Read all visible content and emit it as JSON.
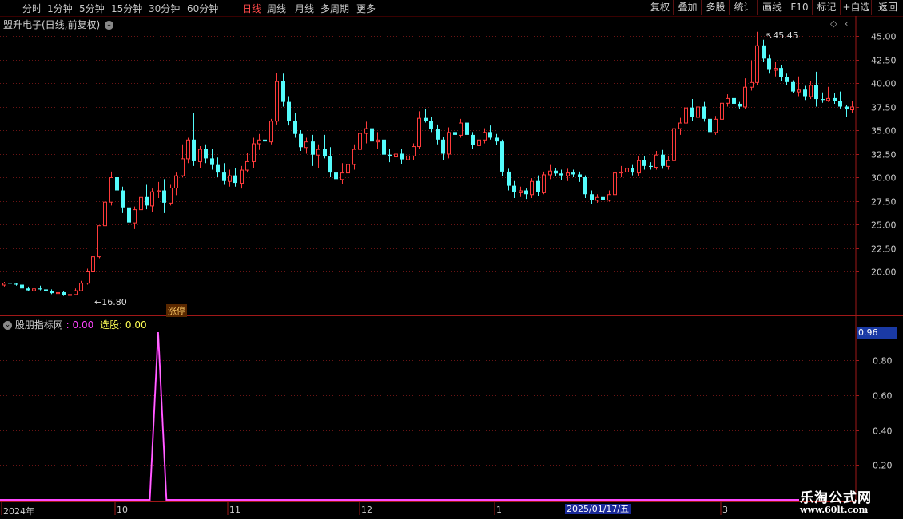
{
  "toolbar": {
    "periods": [
      "分时",
      "1分钟",
      "5分钟",
      "15分钟",
      "30分钟",
      "60分钟",
      "日线",
      "周线",
      "月线",
      "多周期",
      "更多"
    ],
    "active_period": "日线",
    "buttons": [
      "复权",
      "叠加",
      "多股",
      "统计",
      "画线",
      "F10",
      "标记",
      "+自选",
      "返回"
    ]
  },
  "main_chart": {
    "title": "盟升电子(日线,前复权)",
    "y_ticks": [
      "45.00",
      "42.50",
      "40.00",
      "37.50",
      "35.00",
      "32.50",
      "30.00",
      "27.50",
      "25.00",
      "22.50",
      "20.00"
    ],
    "high_label": "45.45",
    "low_label": "16.80",
    "badge": "涨停"
  },
  "indicator": {
    "name": "股朋指标网",
    "value_label": ": 0.00",
    "select_label": "选股: 0.00",
    "current_value": "0.96",
    "y_ticks": [
      "0.80",
      "0.60",
      "0.40",
      "0.20"
    ]
  },
  "x_axis": {
    "labels": [
      "2024年",
      "10",
      "11",
      "12",
      "1",
      "2025/01/17/五",
      "3"
    ]
  },
  "watermark": {
    "title": "乐淘公式网",
    "url": "www.60lt.com"
  },
  "colors": {
    "up": "#ff3b3b",
    "down": "#54fcfc",
    "grid": "#7a1a1a",
    "indicator_line": "#ff33ff"
  },
  "chart_data": {
    "type": "candlestick",
    "title": "盟升电子(日线,前复权)",
    "price_range": [
      16.0,
      46.5
    ],
    "high": 45.45,
    "low": 16.8,
    "candles": [
      [
        18.6,
        18.9,
        18.4,
        18.8
      ],
      [
        18.8,
        18.9,
        18.6,
        18.7
      ],
      [
        18.7,
        18.8,
        18.5,
        18.6
      ],
      [
        18.6,
        18.8,
        18.1,
        18.2
      ],
      [
        18.2,
        18.4,
        17.9,
        18.0
      ],
      [
        18.0,
        18.3,
        17.9,
        18.2
      ],
      [
        18.2,
        18.5,
        18.0,
        18.1
      ],
      [
        18.1,
        18.3,
        17.8,
        17.9
      ],
      [
        17.9,
        18.1,
        17.6,
        17.7
      ],
      [
        17.7,
        17.9,
        17.5,
        17.8
      ],
      [
        17.8,
        17.9,
        17.4,
        17.5
      ],
      [
        17.5,
        17.8,
        17.2,
        17.6
      ],
      [
        17.6,
        18.2,
        17.5,
        18.0
      ],
      [
        18.0,
        19.0,
        17.9,
        18.8
      ],
      [
        18.8,
        20.3,
        18.6,
        20.0
      ],
      [
        20.0,
        21.6,
        19.8,
        21.6
      ],
      [
        21.6,
        23.8,
        21.4,
        24.9
      ],
      [
        24.9,
        28.0,
        24.6,
        27.4
      ],
      [
        27.4,
        30.6,
        27.0,
        30.0
      ],
      [
        30.0,
        30.5,
        28.3,
        28.6
      ],
      [
        28.6,
        29.0,
        26.2,
        26.8
      ],
      [
        26.8,
        27.1,
        24.8,
        25.2
      ],
      [
        25.2,
        26.9,
        24.5,
        26.6
      ],
      [
        26.6,
        28.3,
        26.1,
        27.9
      ],
      [
        27.9,
        29.2,
        26.6,
        27.0
      ],
      [
        27.0,
        28.8,
        26.3,
        28.5
      ],
      [
        28.5,
        29.5,
        27.8,
        28.6
      ],
      [
        28.6,
        29.8,
        26.2,
        27.3
      ],
      [
        27.3,
        29.2,
        27.0,
        28.9
      ],
      [
        28.9,
        30.5,
        28.1,
        30.2
      ],
      [
        30.2,
        33.5,
        30.0,
        32.0
      ],
      [
        32.0,
        34.2,
        31.5,
        34.0
      ],
      [
        34.0,
        36.8,
        31.2,
        31.7
      ],
      [
        31.7,
        33.3,
        31.0,
        33.0
      ],
      [
        33.0,
        33.5,
        31.5,
        32.0
      ],
      [
        32.0,
        33.0,
        30.8,
        31.3
      ],
      [
        31.3,
        32.1,
        30.0,
        30.5
      ],
      [
        30.5,
        31.5,
        29.2,
        29.6
      ],
      [
        29.6,
        30.8,
        29.0,
        30.2
      ],
      [
        30.2,
        31.0,
        29.0,
        29.4
      ],
      [
        29.4,
        31.2,
        28.8,
        30.8
      ],
      [
        30.8,
        32.6,
        30.5,
        31.7
      ],
      [
        31.7,
        34.2,
        31.0,
        33.6
      ],
      [
        33.6,
        34.6,
        32.9,
        34.0
      ],
      [
        34.0,
        35.2,
        33.6,
        33.8
      ],
      [
        33.8,
        36.2,
        33.5,
        36.0
      ],
      [
        36.0,
        41.1,
        35.6,
        40.2
      ],
      [
        40.2,
        41.0,
        37.5,
        38.0
      ],
      [
        38.0,
        38.6,
        35.5,
        36.0
      ],
      [
        36.0,
        36.8,
        34.2,
        34.6
      ],
      [
        34.6,
        35.0,
        32.8,
        33.2
      ],
      [
        33.2,
        34.2,
        32.5,
        33.8
      ],
      [
        33.8,
        34.5,
        31.2,
        32.4
      ],
      [
        32.4,
        33.5,
        31.0,
        33.0
      ],
      [
        33.0,
        34.5,
        32.0,
        32.2
      ],
      [
        32.2,
        33.2,
        30.0,
        30.5
      ],
      [
        30.5,
        30.8,
        28.5,
        29.8
      ],
      [
        29.8,
        31.5,
        29.3,
        30.5
      ],
      [
        30.5,
        32.5,
        30.0,
        31.4
      ],
      [
        31.4,
        33.5,
        30.8,
        33.0
      ],
      [
        33.0,
        35.8,
        32.6,
        34.7
      ],
      [
        34.7,
        35.9,
        33.6,
        35.2
      ],
      [
        35.2,
        35.6,
        33.4,
        33.8
      ],
      [
        33.8,
        34.8,
        33.0,
        34.0
      ],
      [
        34.0,
        34.5,
        32.0,
        32.4
      ],
      [
        32.4,
        33.0,
        31.6,
        32.2
      ],
      [
        32.2,
        33.5,
        31.8,
        32.5
      ],
      [
        32.5,
        33.0,
        31.4,
        31.9
      ],
      [
        31.9,
        32.8,
        31.5,
        32.3
      ],
      [
        32.3,
        33.6,
        31.8,
        33.3
      ],
      [
        33.3,
        37.0,
        33.0,
        36.3
      ],
      [
        36.3,
        37.2,
        35.8,
        36.0
      ],
      [
        36.0,
        36.4,
        34.8,
        35.1
      ],
      [
        35.1,
        35.6,
        33.5,
        34.0
      ],
      [
        34.0,
        34.3,
        31.8,
        32.5
      ],
      [
        32.5,
        35.3,
        32.0,
        34.8
      ],
      [
        34.8,
        35.2,
        34.0,
        34.5
      ],
      [
        34.5,
        36.2,
        34.2,
        35.8
      ],
      [
        35.8,
        36.0,
        34.0,
        34.5
      ],
      [
        34.5,
        34.8,
        33.0,
        33.4
      ],
      [
        33.4,
        34.5,
        32.9,
        34.0
      ],
      [
        34.0,
        35.2,
        33.6,
        34.8
      ],
      [
        34.8,
        35.5,
        34.0,
        34.2
      ],
      [
        34.2,
        34.6,
        33.4,
        33.8
      ],
      [
        33.8,
        34.0,
        30.1,
        30.6
      ],
      [
        30.6,
        30.9,
        28.6,
        29.1
      ],
      [
        29.1,
        29.6,
        27.8,
        28.4
      ],
      [
        28.4,
        29.0,
        27.9,
        28.6
      ],
      [
        28.6,
        28.8,
        27.7,
        28.2
      ],
      [
        28.2,
        29.9,
        27.8,
        29.6
      ],
      [
        29.6,
        30.2,
        28.0,
        28.4
      ],
      [
        28.4,
        30.6,
        28.2,
        30.3
      ],
      [
        30.3,
        31.3,
        29.8,
        30.7
      ],
      [
        30.7,
        31.0,
        30.1,
        30.4
      ],
      [
        30.4,
        30.8,
        29.7,
        30.2
      ],
      [
        30.2,
        30.9,
        29.6,
        30.5
      ],
      [
        30.5,
        30.8,
        30.0,
        30.3
      ],
      [
        30.3,
        30.6,
        29.5,
        30.0
      ],
      [
        30.0,
        30.2,
        27.8,
        28.2
      ],
      [
        28.2,
        28.6,
        27.2,
        27.6
      ],
      [
        27.6,
        28.2,
        27.3,
        27.9
      ],
      [
        27.9,
        28.1,
        27.4,
        27.6
      ],
      [
        27.6,
        28.6,
        27.4,
        28.2
      ],
      [
        28.2,
        31.0,
        28.0,
        30.5
      ],
      [
        30.5,
        31.2,
        30.0,
        30.6
      ],
      [
        30.6,
        31.2,
        29.8,
        31.0
      ],
      [
        31.0,
        31.3,
        30.2,
        30.5
      ],
      [
        30.5,
        32.2,
        30.1,
        31.8
      ],
      [
        31.8,
        32.2,
        30.8,
        31.2
      ],
      [
        31.2,
        31.6,
        30.8,
        31.1
      ],
      [
        31.1,
        32.8,
        30.8,
        32.4
      ],
      [
        32.4,
        32.9,
        30.9,
        31.2
      ],
      [
        31.2,
        32.2,
        30.8,
        31.8
      ],
      [
        31.8,
        36.0,
        31.6,
        35.2
      ],
      [
        35.2,
        36.3,
        34.5,
        35.8
      ],
      [
        35.8,
        37.8,
        35.5,
        37.4
      ],
      [
        37.4,
        38.3,
        36.0,
        36.4
      ],
      [
        36.4,
        37.9,
        36.0,
        37.5
      ],
      [
        37.5,
        38.0,
        35.9,
        36.2
      ],
      [
        36.2,
        36.7,
        34.4,
        34.8
      ],
      [
        34.8,
        36.5,
        34.5,
        36.2
      ],
      [
        36.2,
        38.2,
        36.0,
        37.9
      ],
      [
        37.9,
        38.8,
        37.5,
        38.4
      ],
      [
        38.4,
        38.6,
        37.6,
        37.8
      ],
      [
        37.8,
        38.0,
        37.2,
        37.5
      ],
      [
        37.5,
        40.5,
        37.2,
        39.6
      ],
      [
        39.6,
        42.4,
        39.2,
        40.1
      ],
      [
        40.1,
        45.45,
        39.8,
        44.0
      ],
      [
        44.0,
        44.6,
        42.2,
        42.6
      ],
      [
        42.6,
        43.0,
        41.0,
        41.4
      ],
      [
        41.4,
        42.2,
        40.7,
        41.6
      ],
      [
        41.6,
        41.9,
        40.2,
        40.6
      ],
      [
        40.6,
        41.0,
        39.8,
        40.1
      ],
      [
        40.1,
        40.3,
        38.9,
        39.1
      ],
      [
        39.1,
        40.7,
        38.6,
        39.3
      ],
      [
        39.3,
        39.7,
        38.2,
        38.6
      ],
      [
        38.6,
        40.2,
        38.3,
        39.8
      ],
      [
        39.8,
        41.2,
        37.5,
        38.3
      ],
      [
        38.3,
        39.0,
        37.9,
        38.2
      ],
      [
        38.2,
        39.6,
        38.0,
        38.4
      ],
      [
        38.4,
        38.9,
        37.8,
        38.1
      ],
      [
        38.1,
        39.1,
        37.3,
        37.5
      ],
      [
        37.5,
        37.7,
        36.4,
        37.2
      ],
      [
        37.2,
        38.1,
        36.8,
        37.5
      ]
    ],
    "indicator_series": {
      "name": "股朋指标网",
      "range": [
        0,
        0.96
      ],
      "spike_candle_index": 26,
      "spike_value": 0.96
    }
  }
}
